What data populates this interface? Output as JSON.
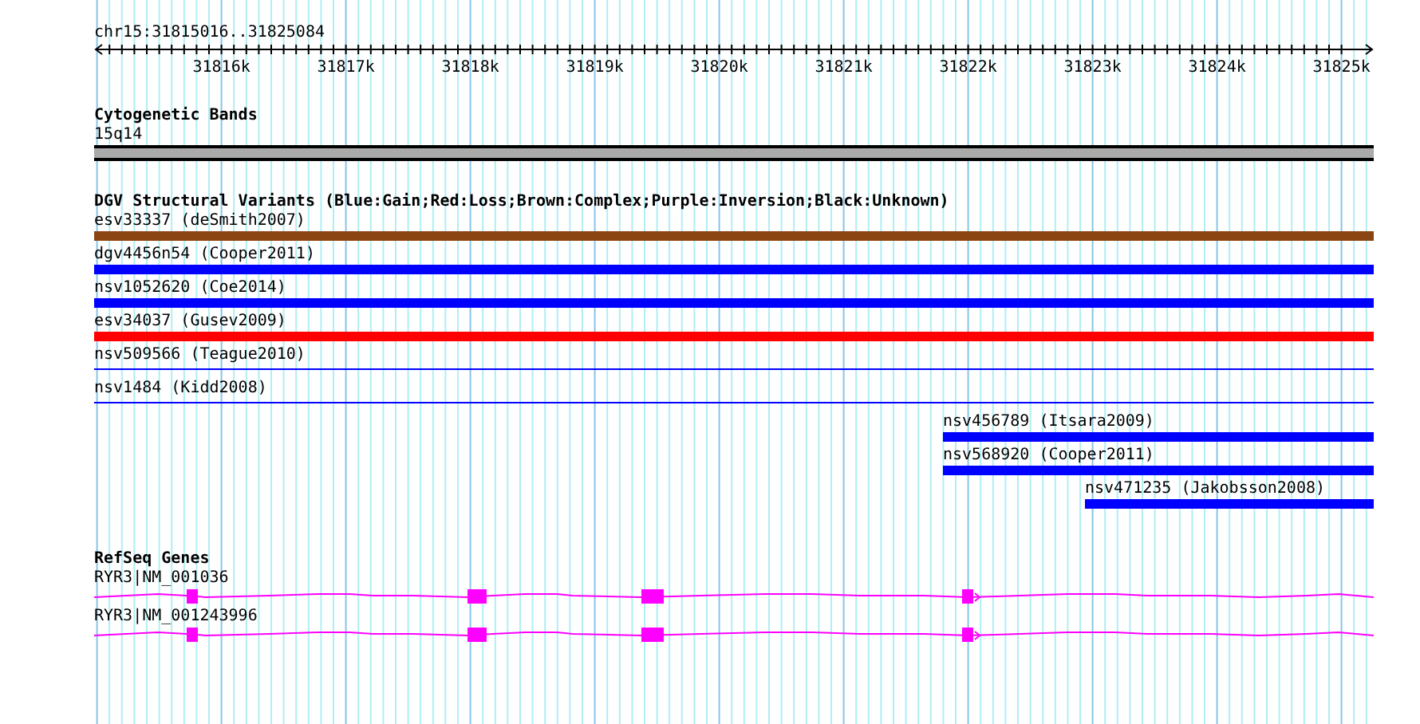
{
  "ruler": {
    "label": "chr15:31815016..31825084",
    "ticks": [
      "31816k",
      "31817k",
      "31818k",
      "31819k",
      "31820k",
      "31821k",
      "31822k",
      "31823k",
      "31824k",
      "31825k"
    ]
  },
  "cytogenetic_bands": {
    "title": "Cytogenetic Bands",
    "band": "15q14"
  },
  "variants": {
    "title": "DGV Structural Variants (Blue:Gain;Red:Loss;Brown:Complex;Purple:Inversion;Black:Unknown)",
    "items": [
      {
        "label": "esv33337 (deSmith2007)",
        "kind": "thick",
        "color": "#8b4513"
      },
      {
        "label": "dgv4456n54 (Cooper2011)",
        "kind": "thick",
        "color": "#0000ff"
      },
      {
        "label": "nsv1052620 (Coe2014)",
        "kind": "thick",
        "color": "#0000ff"
      },
      {
        "label": "esv34037 (Gusev2009)",
        "kind": "thick",
        "color": "#ff0000"
      },
      {
        "label": "nsv509566 (Teague2010)",
        "kind": "thin",
        "color": "#0000ff"
      },
      {
        "label": "nsv1484 (Kidd2008)",
        "kind": "thin",
        "color": "#0000ff"
      },
      {
        "label": "nsv456789 (Itsara2009)",
        "kind": "thick",
        "color": "#0000ff"
      },
      {
        "label": "nsv568920 (Cooper2011)",
        "kind": "thick",
        "color": "#0000ff"
      },
      {
        "label": "nsv471235 (Jakobsson2008)",
        "kind": "thick",
        "color": "#0000ff"
      }
    ]
  },
  "refseq_genes": {
    "title": "RefSeq Genes",
    "transcripts": [
      {
        "label": "RYR3|NM_001036",
        "kind": "transcript"
      },
      {
        "label": "RYR3|NM_001243996",
        "kind": "transcript"
      }
    ]
  }
}
